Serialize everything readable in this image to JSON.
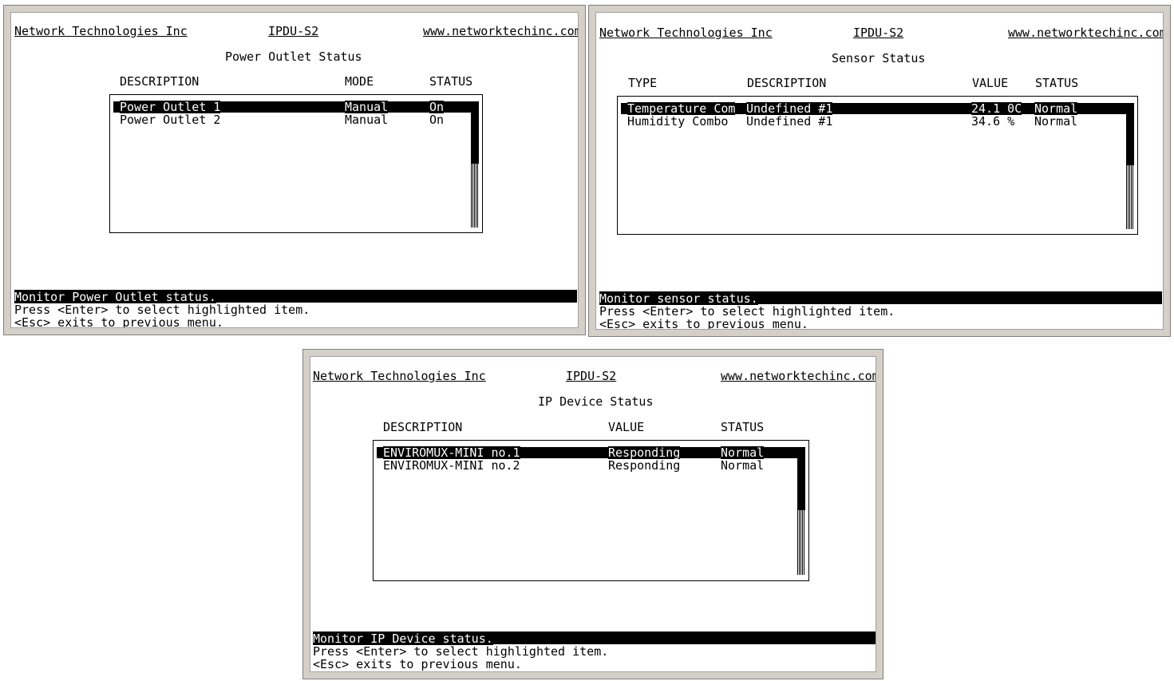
{
  "panels": [
    {
      "id": "power",
      "header": {
        "company": "Network Technologies Inc",
        "model": "IPDU-S2",
        "url": "www.networktechinc.com"
      },
      "title": "Power Outlet Status",
      "columns": [
        "DESCRIPTION",
        "MODE",
        "STATUS"
      ],
      "rows": [
        {
          "cells": [
            "Power Outlet 1",
            "Manual",
            "On"
          ],
          "selected": true
        },
        {
          "cells": [
            "Power Outlet 2",
            "Manual",
            "On"
          ],
          "selected": false
        }
      ],
      "footer": {
        "status": "Monitor Power Outlet status.",
        "hint1": "Press <Enter> to select highlighted item.",
        "hint2": "<Esc> exits to previous menu."
      }
    },
    {
      "id": "sensor",
      "header": {
        "company": "Network Technologies Inc",
        "model": "IPDU-S2",
        "url": "www.networktechinc.com"
      },
      "title": "Sensor Status",
      "columns": [
        "TYPE",
        "DESCRIPTION",
        "VALUE",
        "STATUS"
      ],
      "rows": [
        {
          "cells": [
            "Temperature Com",
            "Undefined #1",
            "24.1 0C",
            "Normal"
          ],
          "selected": true
        },
        {
          "cells": [
            "Humidity Combo",
            "Undefined #1",
            "34.6 %",
            "Normal"
          ],
          "selected": false
        }
      ],
      "footer": {
        "status": "Monitor sensor status.",
        "hint1": "Press <Enter> to select highlighted item.",
        "hint2": "<Esc> exits to previous menu."
      }
    },
    {
      "id": "ipdevice",
      "header": {
        "company": "Network Technologies Inc",
        "model": "IPDU-S2",
        "url": "www.networktechinc.com"
      },
      "title": "IP Device Status",
      "columns": [
        "DESCRIPTION",
        "VALUE",
        "STATUS"
      ],
      "rows": [
        {
          "cells": [
            "ENVIROMUX-MINI no.1",
            "Responding",
            "Normal"
          ],
          "selected": true
        },
        {
          "cells": [
            "ENVIROMUX-MINI no.2",
            "Responding",
            "Normal"
          ],
          "selected": false
        }
      ],
      "footer": {
        "status": "Monitor IP Device status.",
        "hint1": "Press <Enter> to select highlighted item.",
        "hint2": "<Esc> exits to previous menu."
      }
    }
  ]
}
